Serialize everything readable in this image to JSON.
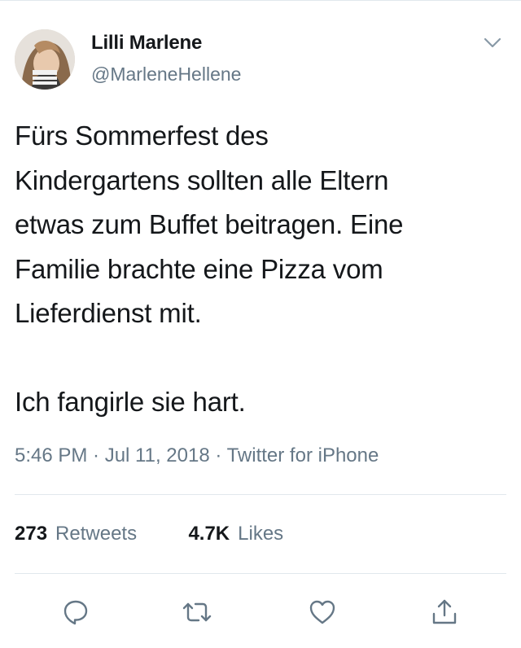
{
  "tweet": {
    "author": {
      "display_name": "Lilli Marlene",
      "handle": "@MarleneHellene"
    },
    "text": "Fürs Sommerfest des\nKindergartens sollten alle Eltern\netwas zum Buffet beitragen. Eine\nFamilie brachte eine Pizza vom\nLieferdienst mit.\n\nIch fangirle sie hart.",
    "timestamp": "5:46 PM · Jul 11, 2018 · Twitter for iPhone",
    "stats": {
      "retweets_count": "273",
      "retweets_label": "Retweets",
      "likes_count": "4.7K",
      "likes_label": "Likes"
    },
    "actions": [
      {
        "icon": "reply-icon"
      },
      {
        "icon": "retweet-icon"
      },
      {
        "icon": "like-icon"
      },
      {
        "icon": "share-icon"
      }
    ]
  },
  "colors": {
    "text_primary": "#14171a",
    "text_secondary": "#657786",
    "divider": "#e1e8ed",
    "icon": "#657786"
  }
}
